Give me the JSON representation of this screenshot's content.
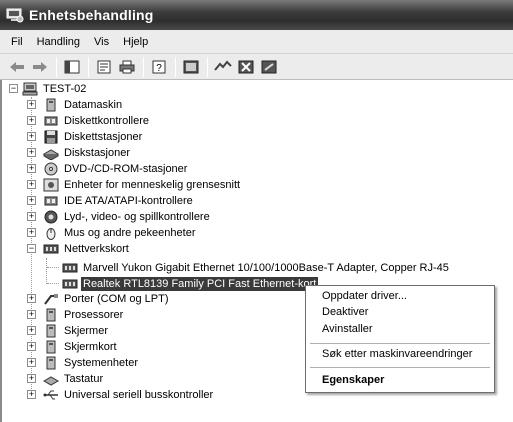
{
  "window": {
    "title": "Enhetsbehandling"
  },
  "menu": [
    "Fil",
    "Handling",
    "Vis",
    "Hjelp"
  ],
  "toolbar": {
    "buttons": [
      "back-icon",
      "forward-icon",
      "show-hide-tree-icon",
      "properties-icon",
      "print-icon",
      "help-icon",
      "scan-hardware-icon",
      "update-driver-icon",
      "uninstall-icon",
      "disable-icon"
    ]
  },
  "tree": {
    "root": "TEST-02",
    "categories": [
      "Datamaskin",
      "Diskettkontrollere",
      "Diskettstasjoner",
      "Diskstasjoner",
      "DVD-/CD-ROM-stasjoner",
      "Enheter for menneskelig grensesnitt",
      "IDE ATA/ATAPI-kontrollere",
      "Lyd-, video- og spillkontrollere",
      "Mus og andre pekeenheter",
      "Nettverkskort"
    ],
    "network_children": [
      "Marvell Yukon Gigabit Ethernet 10/100/1000Base-T Adapter, Copper RJ-45",
      "Realtek RTL8139 Family PCI Fast Ethernet-kort"
    ],
    "categories_after": [
      "Porter (COM og LPT)",
      "Prosessorer",
      "Skjermer",
      "Skjermkort",
      "Systemenheter",
      "Tastatur",
      "Universal seriell busskontroller"
    ]
  },
  "context_menu": {
    "items": [
      "Oppdater driver...",
      "Deaktiver",
      "Avinstaller",
      "Søk etter maskinvareendringer",
      "Egenskaper"
    ]
  }
}
